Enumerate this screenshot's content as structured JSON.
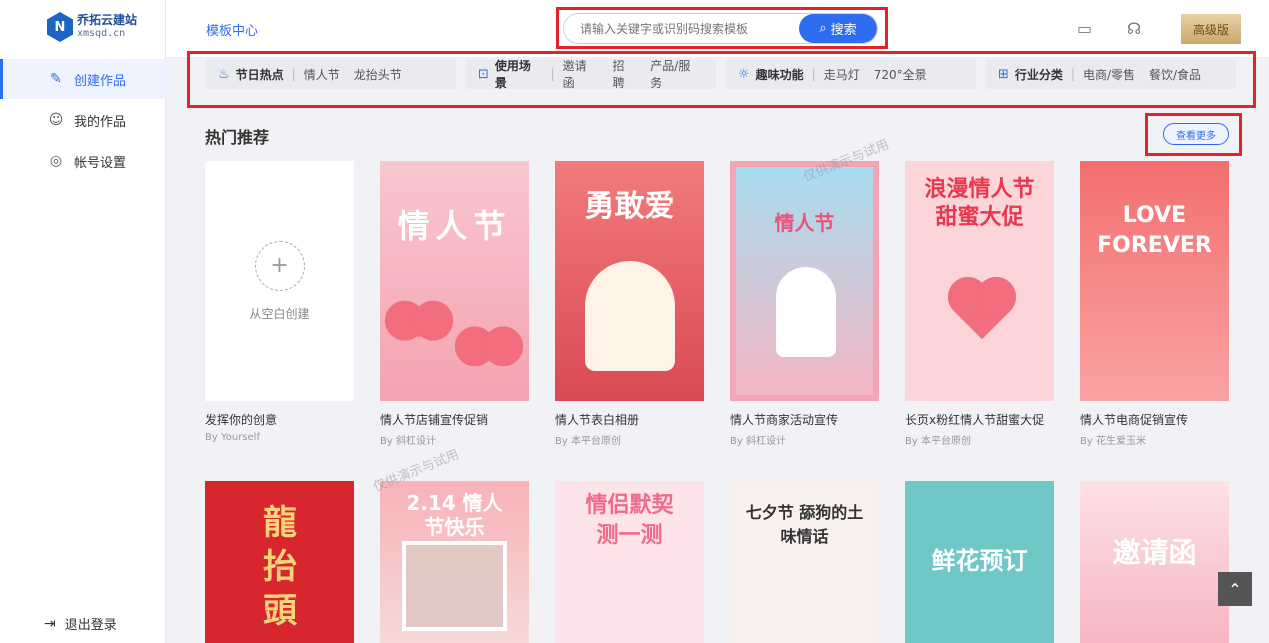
{
  "brand": {
    "name": "乔拓云建站",
    "domain": "xmsqd.cn"
  },
  "sidebar": {
    "items": [
      {
        "label": "创建作品",
        "icon": "edit-icon"
      },
      {
        "label": "我的作品",
        "icon": "user-icon"
      },
      {
        "label": "帐号设置",
        "icon": "settings-icon"
      }
    ],
    "logout_label": "退出登录"
  },
  "topbar": {
    "template_center": "模板中心",
    "search_placeholder": "请输入关键字或识别码搜索模板",
    "search_button": "搜索",
    "pro_label": "高级版"
  },
  "categories": [
    {
      "title": "节日热点",
      "tags": [
        "情人节",
        "龙抬头节"
      ],
      "icon": "flame-icon"
    },
    {
      "title": "使用场景",
      "tags": [
        "邀请函",
        "招聘",
        "产品/服务"
      ],
      "icon": "scan-icon"
    },
    {
      "title": "趣味功能",
      "tags": [
        "走马灯",
        "720°全景"
      ],
      "icon": "bulb-icon"
    },
    {
      "title": "行业分类",
      "tags": [
        "电商/零售",
        "餐饮/食品"
      ],
      "icon": "grid-icon"
    }
  ],
  "section": {
    "title": "热门推荐",
    "more_label": "查看更多"
  },
  "blank_card": {
    "label": "从空白创建",
    "title": "发挥你的创意",
    "author": "By Yourself"
  },
  "cards": [
    {
      "title": "情人节店铺宣传促销",
      "author": "By 斜杠设计",
      "poster_text": "情人节"
    },
    {
      "title": "情人节表白相册",
      "author": "By 本平台原创",
      "poster_text": "勇敢爱"
    },
    {
      "title": "情人节商家活动宣传",
      "author": "By 斜杠设计",
      "poster_text": "情人节"
    },
    {
      "title": "长页x粉红情人节甜蜜大促",
      "author": "By 本平台原创",
      "poster_text": "浪漫情人节 甜蜜大促"
    },
    {
      "title": "情人节电商促销宣传",
      "author": "By 花生爱玉米",
      "poster_text": "LOVE FOREVER"
    }
  ],
  "row2": [
    {
      "poster_text": "龍抬頭"
    },
    {
      "poster_text": "2.14 情人节快乐"
    },
    {
      "poster_text": "情侣默契测一测"
    },
    {
      "poster_text": "七夕节 舔狗的土味情话"
    },
    {
      "poster_text": "鲜花预订"
    },
    {
      "poster_text": "邀请函"
    }
  ],
  "watermark": "仅供演示与试用",
  "colors": {
    "accent": "#2f6df0",
    "highlight": "#e0242a"
  }
}
